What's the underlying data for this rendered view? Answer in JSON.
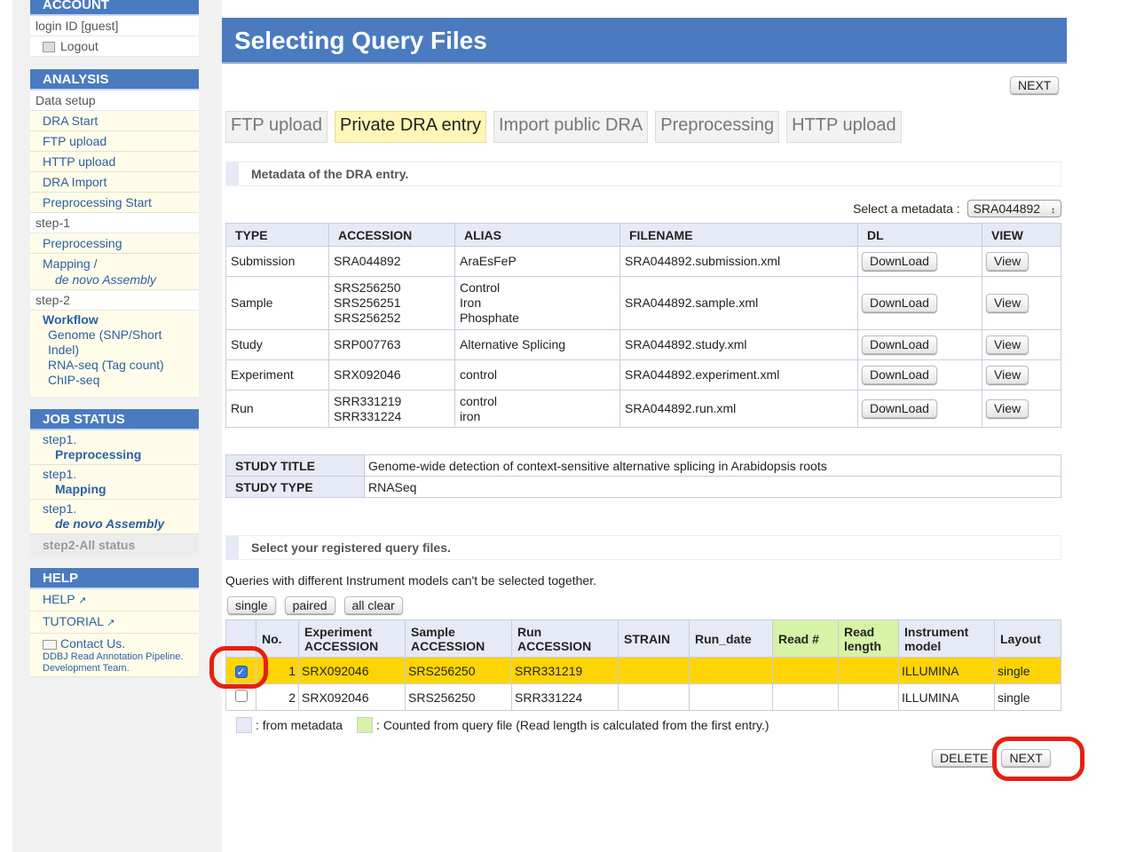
{
  "sidebar": {
    "account": {
      "header": "ACCOUNT",
      "login": "login ID [guest]",
      "logout": "Logout"
    },
    "analysis": {
      "header": "ANALYSIS",
      "data_setup": "Data setup",
      "items": [
        "DRA Start",
        "FTP upload",
        "HTTP upload",
        "DRA Import",
        "Preprocessing Start"
      ],
      "step1": "step-1",
      "preprocessing": "Preprocessing",
      "mapping": "Mapping /",
      "de_novo": "de novo Assembly",
      "step2": "step-2",
      "workflow": "Workflow",
      "genome": "Genome (SNP/Short Indel)",
      "rnaseq": "RNA-seq (Tag count)",
      "chipseq": "ChIP-seq"
    },
    "job_status": {
      "header": "JOB STATUS",
      "job1_step": "step1.",
      "job1_name": "Preprocessing",
      "job2_step": "step1.",
      "job2_name": "Mapping",
      "job3_step": "step1.",
      "job3_name": "de novo Assembly",
      "step2_all": "step2-All status"
    },
    "help": {
      "header": "HELP",
      "help": "HELP",
      "tutorial": "TUTORIAL",
      "contact": "Contact Us.",
      "team": "DDBJ Read Annotation Pipeline. Development Team."
    }
  },
  "main": {
    "title": "Selecting Query Files",
    "next_top": "NEXT",
    "tabs": [
      "FTP upload",
      "Private DRA entry",
      "Import public DRA",
      "Preprocessing",
      "HTTP upload"
    ],
    "metadata_label": "Metadata of the DRA entry.",
    "select_metadata_label": "Select a metadata :",
    "select_metadata_value": "SRA044892",
    "meta_headers": [
      "TYPE",
      "ACCESSION",
      "ALIAS",
      "FILENAME",
      "DL",
      "VIEW"
    ],
    "meta_rows": [
      {
        "type": "Submission",
        "accession": "SRA044892",
        "alias": "AraEsFeP",
        "filename": "SRA044892.submission.xml"
      },
      {
        "type": "Sample",
        "accession": "SRS256250\nSRS256251\nSRS256252",
        "alias": "Control\nIron\nPhosphate",
        "filename": "SRA044892.sample.xml"
      },
      {
        "type": "Study",
        "accession": "SRP007763",
        "alias": "Alternative Splicing",
        "filename": "SRA044892.study.xml"
      },
      {
        "type": "Experiment",
        "accession": "SRX092046",
        "alias": "control",
        "filename": "SRA044892.experiment.xml"
      },
      {
        "type": "Run",
        "accession": "SRR331219\nSRR331224",
        "alias": "control\niron",
        "filename": "SRA044892.run.xml"
      }
    ],
    "download_label": "DownLoad",
    "view_label": "View",
    "study_title_label": "STUDY TITLE",
    "study_title_value": "Genome-wide detection of context-sensitive alternative splicing in Arabidopsis roots",
    "study_type_label": "STUDY TYPE",
    "study_type_value": "RNASeq",
    "query_label": "Select your registered query files.",
    "query_note": "Queries with different Instrument models can't be selected together.",
    "btn_single": "single",
    "btn_paired": "paired",
    "btn_all_clear": "all clear",
    "query_headers": [
      "No.",
      "Experiment ACCESSION",
      "Sample ACCESSION",
      "Run ACCESSION",
      "STRAIN",
      "Run_date",
      "Read #",
      "Read length",
      "Instrument model",
      "Layout"
    ],
    "query_rows": [
      {
        "checked": true,
        "no": "1",
        "experiment": "SRX092046",
        "sample": "SRS256250",
        "run": "SRR331219",
        "strain": "",
        "run_date": "",
        "read_num": "",
        "read_length": "",
        "instrument": "ILLUMINA",
        "layout": "single"
      },
      {
        "checked": false,
        "no": "2",
        "experiment": "SRX092046",
        "sample": "SRS256250",
        "run": "SRR331224",
        "strain": "",
        "run_date": "",
        "read_num": "",
        "read_length": "",
        "instrument": "ILLUMINA",
        "layout": "single"
      }
    ],
    "legend_metadata": ": from metadata",
    "legend_counted": ": Counted from query file (Read length is calculated from the first entry.)",
    "delete_label": "DELETE",
    "next_bottom": "NEXT",
    "colors": {
      "header_blue": "#4a7bc0",
      "selected_row": "#ffd400",
      "highlight_ring": "#e81f10",
      "legend_meta": "#e6eaf6",
      "legend_counted": "#d6f3a6"
    }
  }
}
